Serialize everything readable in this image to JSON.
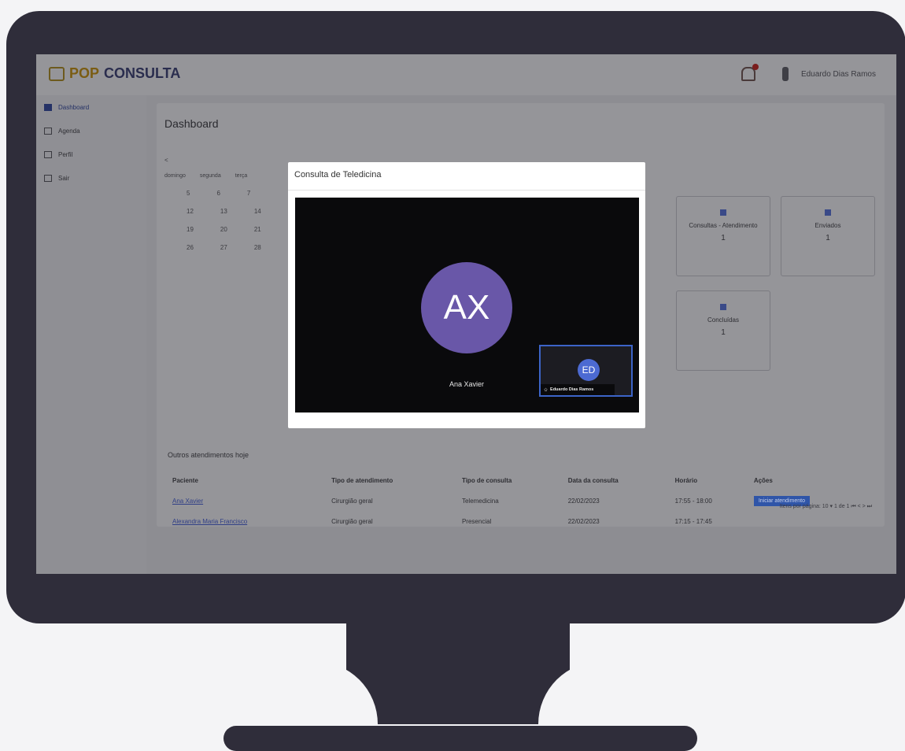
{
  "app": {
    "logo_pop": "POP",
    "logo_consulta": "CONSULTA",
    "user_name": "Eduardo Dias Ramos"
  },
  "sidebar": {
    "items": [
      {
        "label": "Dashboard",
        "icon": "chart-icon"
      },
      {
        "label": "Agenda",
        "icon": "calendar-icon"
      },
      {
        "label": "Perfil",
        "icon": "user-icon"
      },
      {
        "label": "Sair",
        "icon": "logout-icon"
      }
    ]
  },
  "dashboard": {
    "title": "Dashboard",
    "calendar": {
      "prev": "<",
      "days": [
        "domingo",
        "segunda",
        "terça"
      ],
      "weeks": [
        [
          "5",
          "6",
          "7"
        ],
        [
          "12",
          "13",
          "14"
        ],
        [
          "19",
          "20",
          "21"
        ],
        [
          "26",
          "27",
          "28"
        ]
      ]
    },
    "stats": [
      {
        "label": "Consultas - Atendimento",
        "value": "1"
      },
      {
        "label": "Enviados",
        "value": "1"
      },
      {
        "label": "Concluídas",
        "value": "1"
      }
    ],
    "table": {
      "title": "Outros atendimentos hoje",
      "columns": [
        "Paciente",
        "Tipo de atendimento",
        "Tipo de consulta",
        "Data da consulta",
        "Horário",
        "Ações"
      ],
      "rows": [
        [
          "Ana Xavier",
          "Cirurgião geral",
          "Telemedicina",
          "22/02/2023",
          "17:55 - 18:00",
          "Iniciar atendimento"
        ],
        [
          "Alexandra Maria Francisco",
          "Cirurgião geral",
          "Presencial",
          "22/02/2023",
          "17:15 - 17:45",
          ""
        ]
      ]
    },
    "pager": "Itens por página:  10  ▾     1 de 1    ⏮  <  >  ⏭"
  },
  "modal": {
    "title": "Consulta de Teledicina",
    "main_initials": "AX",
    "main_name": "Ana Xavier",
    "pip_initials": "ED",
    "pip_name": "Eduardo Dias Ramos"
  },
  "colors": {
    "monitor": "#2f2d3a",
    "avatar_main": "#6957a8",
    "avatar_pip": "#4c6ad2",
    "pip_border": "#3c64c8"
  }
}
